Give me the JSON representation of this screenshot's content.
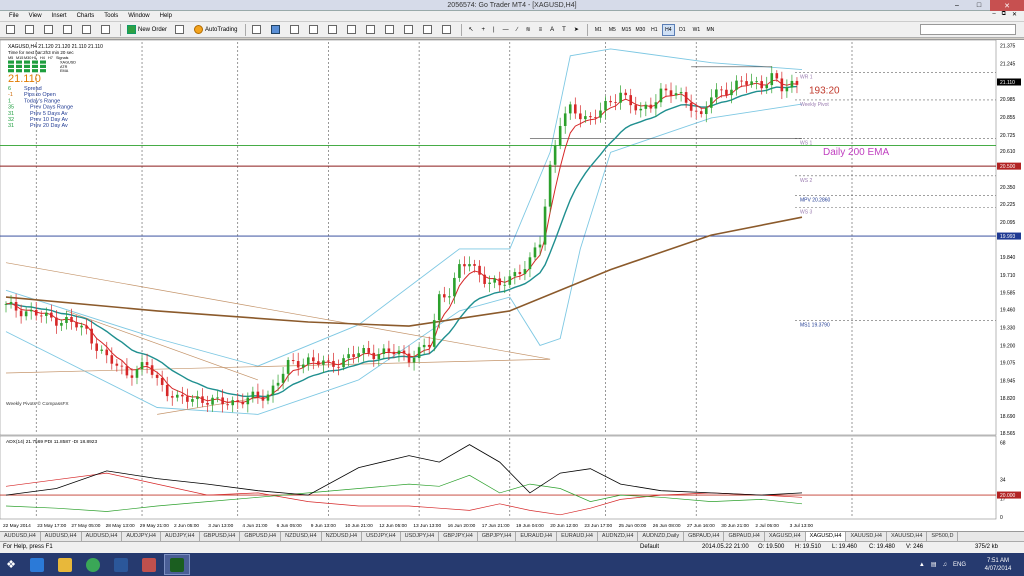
{
  "window": {
    "title": "2056574: Go Trader MT4 - [XAGUSD,H4]"
  },
  "menu": [
    "File",
    "View",
    "Insert",
    "Charts",
    "Tools",
    "Window",
    "Help"
  ],
  "toolbar": {
    "new_order": "New Order",
    "autotrading": "AutoTrading",
    "timeframes": [
      "M1",
      "M5",
      "M15",
      "M30",
      "H1",
      "H4",
      "D1",
      "W1",
      "MN"
    ],
    "active_timeframe": "H4"
  },
  "chart_data": {
    "type": "candlestick",
    "symbol_header": "XAGUSD,H4  21.120 21.120 21.110 21.110",
    "bar_timer": "Time for next bar:2h3 min 20 sec",
    "price_big": "21.110",
    "info_lines": [
      {
        "value": "6",
        "label": "Spread"
      },
      {
        "value": "-1",
        "label": "Pips to Open"
      },
      {
        "value": "1",
        "label": "Today's Range"
      },
      {
        "value": "35",
        "label": "Prev Days Range"
      },
      {
        "value": "31",
        "label": "Prev 5 Days Av"
      },
      {
        "value": "32",
        "label": "Prev 10 Day Av"
      },
      {
        "value": "31",
        "label": "Prev 20 Day Av"
      }
    ],
    "signal_cols": [
      "M5",
      "M15",
      "M30",
      "H1",
      "H4",
      "H7",
      "Signals"
    ],
    "signal_rows": [
      "XAGUSD",
      "ATR",
      "EMA"
    ],
    "y_ticks": [
      21.375,
      21.245,
      21.11,
      20.985,
      20.855,
      20.725,
      20.61,
      20.5,
      20.35,
      20.225,
      20.095,
      19.993,
      19.84,
      19.71,
      19.585,
      19.46,
      19.33,
      19.2,
      19.075,
      18.945,
      18.82,
      18.69,
      18.565
    ],
    "y_tick_labels": [
      "21.375",
      "21.245",
      "21.110",
      "20.985",
      "20.855",
      "20.725",
      "20.610",
      "20.500",
      "20.350",
      "20.225",
      "20.095",
      "19.993",
      "19.840",
      "19.710",
      "19.585",
      "19.460",
      "19.330",
      "19.200",
      "19.075",
      "18.945",
      "18.820",
      "18.690",
      "18.565"
    ],
    "ylim": [
      18.565,
      21.4
    ],
    "x_labels": [
      "22 May 2014",
      "23 May 17:00",
      "27 May 05:00",
      "28 May 13:00",
      "29 May 21:00",
      "2 Jun 05:00",
      "3 Jun 13:00",
      "4 Jun 21:00",
      "6 Jun 05:00",
      "9 Jun 13:00",
      "10 Jun 21:00",
      "12 Jun 05:00",
      "13 Jun 13:00",
      "16 Jun 20:00",
      "17 Jun 21:00",
      "19 Jun 04:00",
      "20 Jun 12:00",
      "23 Jun 17:00",
      "25 Jun 00:00",
      "26 Jun 08:00",
      "27 Jun 16:00",
      "30 Jun 21:00",
      "2 Jul 05:00",
      "3 Jul 13:00"
    ],
    "close_path": [
      [
        0,
        19.48
      ],
      [
        4,
        19.45
      ],
      [
        8,
        19.4
      ],
      [
        12,
        19.38
      ],
      [
        16,
        19.3
      ],
      [
        20,
        19.1
      ],
      [
        24,
        19.0
      ],
      [
        28,
        19.05
      ],
      [
        30,
        18.95
      ],
      [
        34,
        18.8
      ],
      [
        38,
        18.82
      ],
      [
        42,
        18.78
      ],
      [
        46,
        18.8
      ],
      [
        50,
        18.82
      ],
      [
        52,
        18.85
      ],
      [
        56,
        19.05
      ],
      [
        60,
        19.1
      ],
      [
        64,
        19.05
      ],
      [
        68,
        19.12
      ],
      [
        72,
        19.15
      ],
      [
        76,
        19.15
      ],
      [
        80,
        19.12
      ],
      [
        84,
        19.2
      ],
      [
        86,
        19.55
      ],
      [
        88,
        19.6
      ],
      [
        90,
        19.75
      ],
      [
        92,
        19.8
      ],
      [
        94,
        19.72
      ],
      [
        96,
        19.66
      ],
      [
        98,
        19.62
      ],
      [
        100,
        19.7
      ],
      [
        104,
        19.8
      ],
      [
        106,
        19.95
      ],
      [
        108,
        20.5
      ],
      [
        110,
        20.82
      ],
      [
        112,
        20.9
      ],
      [
        116,
        20.85
      ],
      [
        118,
        20.9
      ],
      [
        120,
        20.95
      ],
      [
        122,
        21.05
      ],
      [
        124,
        20.95
      ],
      [
        126,
        20.88
      ],
      [
        128,
        20.95
      ],
      [
        130,
        21.05
      ],
      [
        134,
        21.0
      ],
      [
        136,
        20.95
      ],
      [
        138,
        20.85
      ],
      [
        140,
        21.0
      ],
      [
        142,
        21.05
      ],
      [
        146,
        21.1
      ],
      [
        150,
        21.1
      ],
      [
        152,
        21.15
      ],
      [
        154,
        21.05
      ],
      [
        156,
        21.1
      ],
      [
        158,
        21.11
      ]
    ],
    "ema200_path": [
      [
        0,
        19.55
      ],
      [
        30,
        19.45
      ],
      [
        60,
        19.37
      ],
      [
        80,
        19.34
      ],
      [
        100,
        19.45
      ],
      [
        120,
        19.75
      ],
      [
        140,
        20.0
      ],
      [
        158,
        20.13
      ]
    ],
    "bb_upper_path": [
      [
        0,
        19.6
      ],
      [
        30,
        19.25
      ],
      [
        50,
        19.05
      ],
      [
        70,
        19.35
      ],
      [
        90,
        19.9
      ],
      [
        100,
        19.9
      ],
      [
        108,
        20.6
      ],
      [
        112,
        21.3
      ],
      [
        120,
        21.35
      ],
      [
        140,
        21.25
      ],
      [
        158,
        21.2
      ]
    ],
    "bb_lower_path": [
      [
        0,
        19.3
      ],
      [
        30,
        18.75
      ],
      [
        50,
        18.7
      ],
      [
        70,
        18.95
      ],
      [
        90,
        19.45
      ],
      [
        100,
        19.55
      ],
      [
        106,
        19.2
      ],
      [
        110,
        19.25
      ],
      [
        114,
        19.9
      ],
      [
        120,
        20.6
      ],
      [
        140,
        20.85
      ],
      [
        158,
        20.95
      ]
    ],
    "pivots": [
      {
        "label": "WR 1",
        "value": 21.18
      },
      {
        "label": "Weekly Pivot",
        "value": 20.98
      },
      {
        "label": "WS 1",
        "value": 20.7
      },
      {
        "label": "WS 2",
        "value": 20.43
      },
      {
        "label": "MPV  20.2860",
        "value": 20.286
      },
      {
        "label": "WS 3",
        "value": 20.2
      },
      {
        "label": "MS1  19.3790",
        "value": 19.379
      }
    ],
    "hlines": [
      {
        "value": 20.65,
        "color": "#2ca02c"
      },
      {
        "value": 20.5,
        "color": "#8b1a1a"
      },
      {
        "value": 19.993,
        "color": "#1f3a93"
      }
    ],
    "price_tags": [
      {
        "value": 21.11,
        "text": "21.110",
        "bg": "#000000"
      },
      {
        "value": 20.5,
        "text": "20.500",
        "bg": "#b22222"
      },
      {
        "value": 19.993,
        "text": "19.993",
        "bg": "#1f3a93"
      }
    ],
    "annotations": {
      "timer": "193:20",
      "ema_label": "Daily 200 EMA",
      "credit": "Weekly Pivots © CompassFX"
    },
    "adx": {
      "header": "ADX(14) 21.7569  PDI 11.8587  -DI 18.8923",
      "y_ticks": [
        68,
        34,
        20,
        17,
        0
      ],
      "y_tick_labels": [
        "68",
        "34",
        "20.000",
        "17",
        "0"
      ],
      "level_tag": "20.000",
      "ylim": [
        0,
        72
      ],
      "adx_path": [
        [
          0,
          20
        ],
        [
          10,
          26
        ],
        [
          20,
          42
        ],
        [
          30,
          35
        ],
        [
          40,
          30
        ],
        [
          50,
          24
        ],
        [
          60,
          20
        ],
        [
          70,
          45
        ],
        [
          80,
          56
        ],
        [
          86,
          50
        ],
        [
          92,
          66
        ],
        [
          98,
          50
        ],
        [
          104,
          22
        ],
        [
          110,
          40
        ],
        [
          116,
          44
        ],
        [
          122,
          30
        ],
        [
          130,
          24
        ],
        [
          140,
          22
        ],
        [
          150,
          20
        ],
        [
          158,
          22
        ]
      ],
      "plus_path": [
        [
          0,
          10
        ],
        [
          10,
          8
        ],
        [
          20,
          5
        ],
        [
          30,
          10
        ],
        [
          40,
          14
        ],
        [
          50,
          18
        ],
        [
          60,
          22
        ],
        [
          70,
          26
        ],
        [
          80,
          30
        ],
        [
          86,
          28
        ],
        [
          92,
          38
        ],
        [
          98,
          22
        ],
        [
          104,
          30
        ],
        [
          110,
          26
        ],
        [
          116,
          14
        ],
        [
          122,
          20
        ],
        [
          130,
          18
        ],
        [
          140,
          14
        ],
        [
          150,
          16
        ],
        [
          158,
          12
        ]
      ],
      "minus_path": [
        [
          0,
          28
        ],
        [
          10,
          34
        ],
        [
          20,
          40
        ],
        [
          30,
          30
        ],
        [
          40,
          20
        ],
        [
          50,
          22
        ],
        [
          60,
          14
        ],
        [
          70,
          10
        ],
        [
          80,
          10
        ],
        [
          86,
          8
        ],
        [
          92,
          6
        ],
        [
          98,
          12
        ],
        [
          104,
          6
        ],
        [
          110,
          2
        ],
        [
          116,
          8
        ],
        [
          122,
          16
        ],
        [
          130,
          20
        ],
        [
          140,
          22
        ],
        [
          150,
          20
        ],
        [
          158,
          18
        ]
      ]
    },
    "bar_count": 158
  },
  "symbol_tabs": [
    "AUDUSD,H4",
    "AUDUSD,H4",
    "AUDUSD,H4",
    "AUDJPY,H4",
    "AUDJPY,H4",
    "GBPUSD,H4",
    "GBPUSD,H4",
    "NZDUSD,H4",
    "NZDUSD,H4",
    "USDJPY,H4",
    "USDJPY,H4",
    "GBPJPY,H4",
    "GBPJPY,H4",
    "EURAUD,H4",
    "EURAUD,H4",
    "AUDNZD,H4",
    "AUDNZD,Daily",
    "GBPAUD,H4",
    "GBPAUD,H4",
    "XAGUSD,H4",
    "XAGUSD,H4",
    "XAUUSD,H4",
    "XAUUSD,H4",
    "SP500,D"
  ],
  "active_tab": 20,
  "status": {
    "help": "For Help, press F1",
    "profile": "Default",
    "datetime": "2014.05.22 21:00",
    "open": "O: 19.500",
    "high": "H: 19.510",
    "low": "L: 19.460",
    "close": "C: 19.480",
    "volume": "V: 246",
    "traffic": "375/2 kb"
  },
  "taskbar": {
    "lang": "ENG",
    "time": "7:51 AM",
    "date": "4/07/2014"
  },
  "colors": {
    "bull": "#2ca02c",
    "bear": "#d62728",
    "ema_fast": "#d62728",
    "ema_mid": "#1f8f8f",
    "ema200": "#8b5a2b",
    "bb": "#7ec8e3",
    "adx_main": "#000000",
    "adx_plus": "#2ca02c",
    "adx_minus": "#d62728"
  }
}
